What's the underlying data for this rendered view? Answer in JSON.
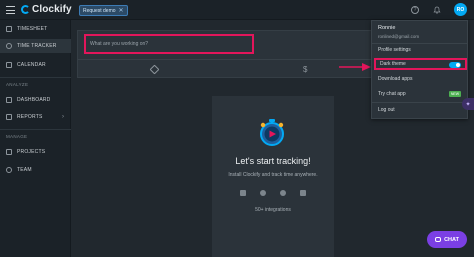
{
  "app": {
    "logo_text": "Clockify",
    "brand_color": "#03a9f4",
    "highlight_color": "#e3165b"
  },
  "topbar": {
    "chip_label": "Request demo",
    "chip_close": "✕",
    "help_glyph": "?",
    "avatar_initials": "RO"
  },
  "sidebar": {
    "items_top": [
      {
        "label": "TIMESHEET",
        "icon": "timesheet-icon"
      },
      {
        "label": "TIME TRACKER",
        "icon": "clock-icon",
        "active": true
      },
      {
        "label": "CALENDAR",
        "icon": "calendar-icon"
      }
    ],
    "analyze_label": "ANALYZE",
    "items_analyze": [
      {
        "label": "DASHBOARD",
        "icon": "dashboard-icon"
      },
      {
        "label": "REPORTS",
        "icon": "reports-icon",
        "chevron": "›"
      }
    ],
    "manage_label": "MANAGE",
    "items_manage": [
      {
        "label": "PROJECTS",
        "icon": "folder-icon"
      },
      {
        "label": "TEAM",
        "icon": "team-icon"
      }
    ]
  },
  "entry": {
    "placeholder": "What are you working on?",
    "dollar_glyph": "$"
  },
  "empty_state": {
    "title": "Let's start tracking!",
    "text": "Install Clockify and track time anywhere.",
    "integrations": "50+ integrations",
    "platform_icons": [
      "android-icon",
      "apple-icon",
      "browser-icon",
      "windows-icon"
    ]
  },
  "dropdown": {
    "name": "Ronnie",
    "email": "ronlined@gmail.com",
    "profile_settings": "Profile settings",
    "dark_theme": "Dark theme",
    "dark_theme_on": true,
    "download_apps": "Download apps",
    "try_chat": "Try chat app",
    "new_badge": "NEW",
    "log_out": "Log out"
  },
  "chat": {
    "label": "CHAT"
  }
}
